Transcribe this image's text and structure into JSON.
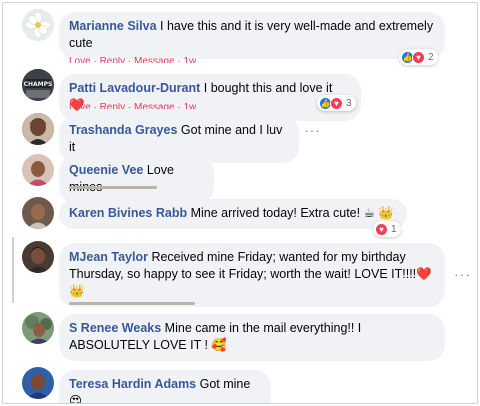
{
  "colors": {
    "author": "#385898",
    "bubble": "#f0f2f5",
    "like": "#1877f2",
    "love": "#f33e58"
  },
  "comments": [
    {
      "author": "Marianne Silva",
      "text": "I have this and it is very well-made and extremely cute",
      "reactions": {
        "icons": [
          "like-icon",
          "love-icon"
        ],
        "count": "2"
      },
      "cropped_actions": "Love · Reply · Message · 1w"
    },
    {
      "author": "Patti Lavadour-Durant",
      "text": "I bought this and love it ❤️",
      "reactions": {
        "icons": [
          "like-icon",
          "love-icon"
        ],
        "count": "3"
      },
      "cropped_actions": "Love · Reply · Message · 1w"
    },
    {
      "author": "Trashanda Grayes",
      "text": "Got mine and I luv it",
      "more": "···"
    },
    {
      "author": "Queenie Vee",
      "text": "Love mines"
    },
    {
      "author": "Karen Bivines Rabb",
      "text": "Mine arrived today! Extra cute! ☕ 👑",
      "reactions": {
        "icons": [
          "love-icon"
        ],
        "count": "1"
      }
    },
    {
      "author": "MJean Taylor",
      "text": "Received mine Friday; wanted for my birthday Thursday, so happy to see it Friday; worth the wait! LOVE IT!!!!❤️ 👑",
      "more": "···"
    },
    {
      "author": "S Renee Weaks",
      "text": "Mine came in the mail everything!! I ABSOLUTELY LOVE IT ! 🥰"
    },
    {
      "author": "Teresa Hardin Adams",
      "text": "Got mine😍"
    }
  ]
}
